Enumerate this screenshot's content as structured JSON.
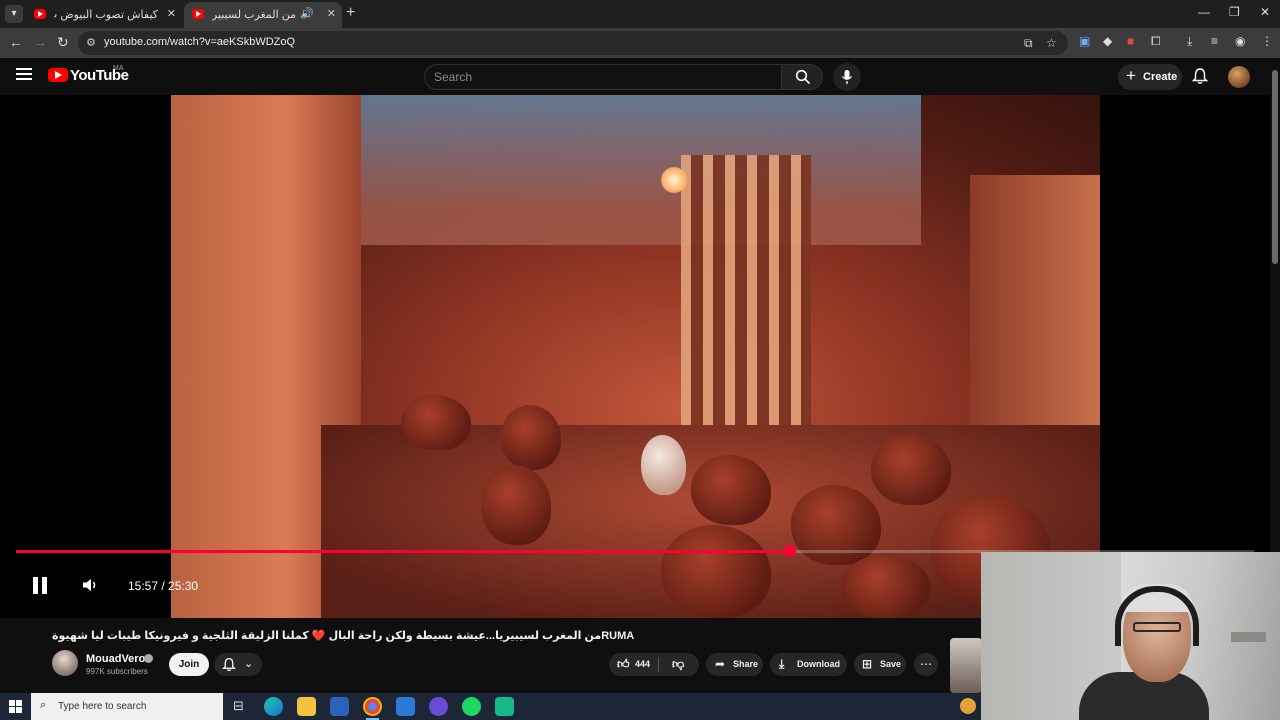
{
  "browser": {
    "tabs": [
      {
        "title": "كيفاش تصوب البيوض ب الاعشاب...",
        "active": false
      },
      {
        "title": "من المغرب لسيبيريا...عيشة بـ",
        "active": true,
        "playing_audio": true
      }
    ],
    "address": {
      "url": "youtube.com/watch?v=aeKSkbWDZoQ"
    }
  },
  "youtube": {
    "logo_text": "YouTube",
    "region": "MA",
    "search_placeholder": "Search",
    "create_label": "Create"
  },
  "player": {
    "current_time": "15:57",
    "duration": "25:30",
    "time_display": "15:57 / 25:30",
    "progress_fraction": 0.6256,
    "state": "playing"
  },
  "video": {
    "title": "من المغرب لسيبيريا...عيشة بسيطة ولكن راحة البال ❤️ كملنا الزليقة الثلجية و فيرونيكا طيبات ليا شهيوة",
    "title_prefix": "RUMA",
    "channel": {
      "name": "MouadVero",
      "subscribers": "997K subscribers",
      "verified": true
    },
    "join_label": "Join",
    "likes": "444",
    "share_label": "Share",
    "download_label": "Download",
    "save_label": "Save"
  },
  "taskbar": {
    "search_placeholder": "Type here to search"
  },
  "colors": {
    "accent": "#ff0033",
    "background": "#0f0f0f",
    "pill": "#272727"
  }
}
